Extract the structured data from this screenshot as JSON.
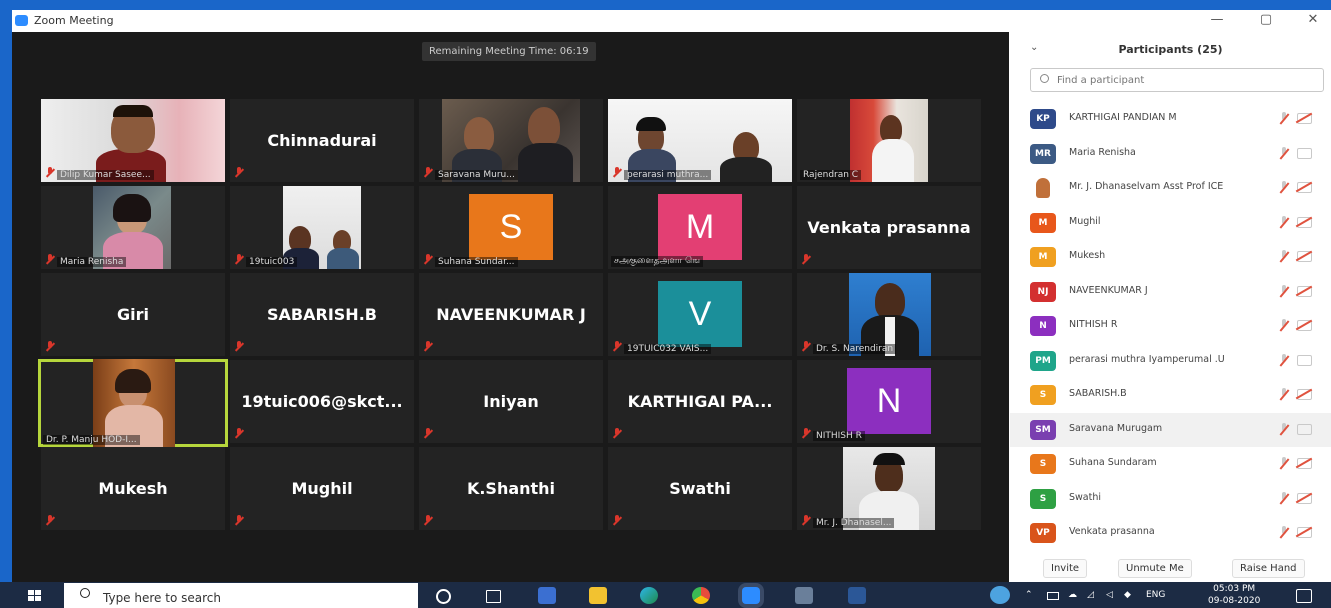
{
  "window": {
    "title": "Zoom Meeting",
    "minimize": "—",
    "restore": "▢",
    "close": "✕"
  },
  "meeting": {
    "timer": "Remaining Meeting Time: 06:19"
  },
  "tiles": [
    {
      "label": "Dilip Kumar Sasee..."
    },
    {
      "name": "Chinnadurai"
    },
    {
      "label": "Saravana Muru..."
    },
    {
      "label": "perarasi muthra..."
    },
    {
      "label": "Rajendran C"
    },
    {
      "label": "Maria Renisha"
    },
    {
      "label": "19tuic003"
    },
    {
      "avatar_letter": "S",
      "avatar_color": "#e8771b",
      "label": "Suhana Sundar..."
    },
    {
      "avatar_letter": "M",
      "avatar_color": "#e33f73",
      "label": "சஅகுளைதஅளா ஙெ"
    },
    {
      "name": "Venkata prasanna"
    },
    {
      "name": "Giri"
    },
    {
      "name": "SABARISH.B"
    },
    {
      "name": "NAVEENKUMAR J"
    },
    {
      "avatar_letter": "V",
      "avatar_color": "#1b8f9a",
      "label": "19TUIC032 VAIS..."
    },
    {
      "label": "Dr. S. Narendiran"
    },
    {
      "label": "Dr. P. Manju HOD-I..."
    },
    {
      "name": "19tuic006@skct..."
    },
    {
      "name": "Iniyan"
    },
    {
      "name": "KARTHIGAI  PA..."
    },
    {
      "avatar_letter": "N",
      "avatar_color": "#8c2fbf",
      "label": "NITHISH R"
    },
    {
      "name": "Mukesh"
    },
    {
      "name": "Mughil"
    },
    {
      "name": "K.Shanthi"
    },
    {
      "name": "Swathi"
    },
    {
      "label": "Mr. J. Dhanasel..."
    }
  ],
  "participants": {
    "title": "Participants (25)",
    "collapse": "⌄",
    "search_placeholder": "Find a participant",
    "rows": [
      {
        "initials": "KP",
        "color": "#2e4a8a",
        "name": "KARTHIGAI PANDIAN M",
        "camera": "off"
      },
      {
        "initials": "MR",
        "color": "#3c5a84",
        "name": "Maria Renisha",
        "camera": "on"
      },
      {
        "initials": "",
        "color": "#c0703a",
        "name": "Mr. J. Dhanaselvam Asst Prof ICE",
        "camera": "off"
      },
      {
        "initials": "M",
        "color": "#e8571b",
        "name": "Mughil",
        "camera": "off"
      },
      {
        "initials": "M",
        "color": "#f0a020",
        "name": "Mukesh",
        "camera": "off"
      },
      {
        "initials": "NJ",
        "color": "#d33030",
        "name": "NAVEENKUMAR J",
        "camera": "off"
      },
      {
        "initials": "N",
        "color": "#8c2fbf",
        "name": "NITHISH R",
        "camera": "off"
      },
      {
        "initials": "PM",
        "color": "#1fa58a",
        "name": "perarasi muthra Iyamperumal .U",
        "camera": "on"
      },
      {
        "initials": "S",
        "color": "#f0a020",
        "name": "SABARISH.B",
        "camera": "off"
      },
      {
        "initials": "SM",
        "color": "#7a3fb0",
        "name": "Saravana Murugam",
        "camera": "on"
      },
      {
        "initials": "S",
        "color": "#e8771b",
        "name": "Suhana Sundaram",
        "camera": "off"
      },
      {
        "initials": "S",
        "color": "#2ea043",
        "name": "Swathi",
        "camera": "off"
      },
      {
        "initials": "VP",
        "color": "#d9541b",
        "name": "Venkata prasanna",
        "camera": "off"
      }
    ],
    "buttons": {
      "invite": "Invite",
      "unmute": "Unmute Me",
      "raise_hand": "Raise Hand"
    }
  },
  "taskbar": {
    "search_placeholder": "Type here to search",
    "tray_lang": "ENG",
    "time": "05:03 PM",
    "date": "09-08-2020"
  }
}
